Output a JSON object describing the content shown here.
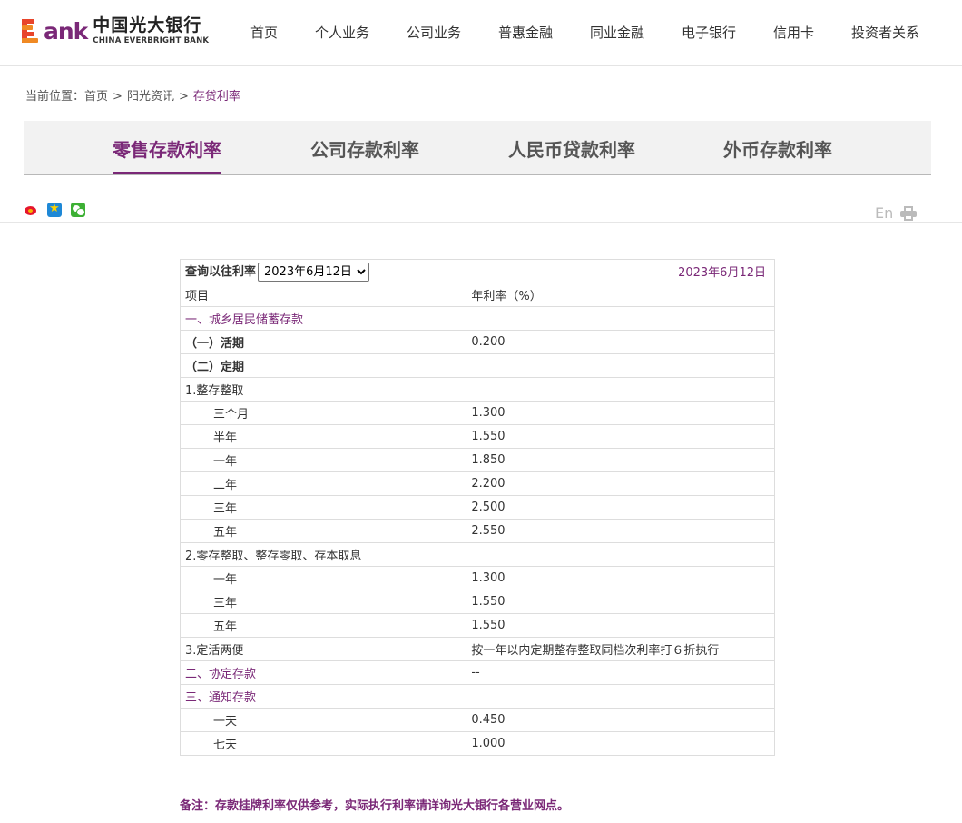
{
  "header": {
    "logo_mark_text": "ank",
    "logo_cn": "中国光大银行",
    "logo_en": "CHINA EVERBRIGHT BANK",
    "nav": [
      "首页",
      "个人业务",
      "公司业务",
      "普惠金融",
      "同业金融",
      "电子银行",
      "信用卡",
      "投资者关系"
    ]
  },
  "breadcrumb": {
    "prefix": "当前位置：",
    "items": [
      "首页",
      "阳光资讯",
      "存贷利率"
    ],
    "separator": ">"
  },
  "tabs": [
    "零售存款利率",
    "公司存款利率",
    "人民币贷款利率",
    "外币存款利率"
  ],
  "active_tab": 0,
  "tools": {
    "lang": "En"
  },
  "table": {
    "query_label": "查询以往利率",
    "selected_date": "2023年6月12日",
    "display_date": "2023年6月12日",
    "header": [
      "项目",
      "年利率（%）"
    ],
    "rows": [
      {
        "item": "一、城乡居民储蓄存款",
        "rate": "",
        "style": "purple"
      },
      {
        "item": "（一）活期",
        "rate": "0.200",
        "style": "bold"
      },
      {
        "item": "（二）定期",
        "rate": "",
        "style": "bold"
      },
      {
        "item": "1.整存整取",
        "rate": "",
        "style": ""
      },
      {
        "item": "三个月",
        "rate": "1.300",
        "style": "indent"
      },
      {
        "item": "半年",
        "rate": "1.550",
        "style": "indent"
      },
      {
        "item": "一年",
        "rate": "1.850",
        "style": "indent"
      },
      {
        "item": "二年",
        "rate": "2.200",
        "style": "indent"
      },
      {
        "item": "三年",
        "rate": "2.500",
        "style": "indent"
      },
      {
        "item": "五年",
        "rate": "2.550",
        "style": "indent"
      },
      {
        "item": "2.零存整取、整存零取、存本取息",
        "rate": "",
        "style": ""
      },
      {
        "item": "一年",
        "rate": "1.300",
        "style": "indent"
      },
      {
        "item": "三年",
        "rate": "1.550",
        "style": "indent"
      },
      {
        "item": "五年",
        "rate": "1.550",
        "style": "indent"
      },
      {
        "item": "3.定活两便",
        "rate": "按一年以内定期整存整取同档次利率打６折执行",
        "style": ""
      },
      {
        "item": "二、协定存款",
        "rate": "--",
        "style": "purple"
      },
      {
        "item": "三、通知存款",
        "rate": "",
        "style": "purple"
      },
      {
        "item": "一天",
        "rate": "0.450",
        "style": "indent"
      },
      {
        "item": "七天",
        "rate": "1.000",
        "style": "indent"
      }
    ]
  },
  "remark": "备注：存款挂牌利率仅供参考，实际执行利率请详询光大银行各营业网点。",
  "colors": {
    "brand_purple": "#7a2877",
    "logo_red": "#e8452b",
    "logo_orange": "#f08a24"
  }
}
